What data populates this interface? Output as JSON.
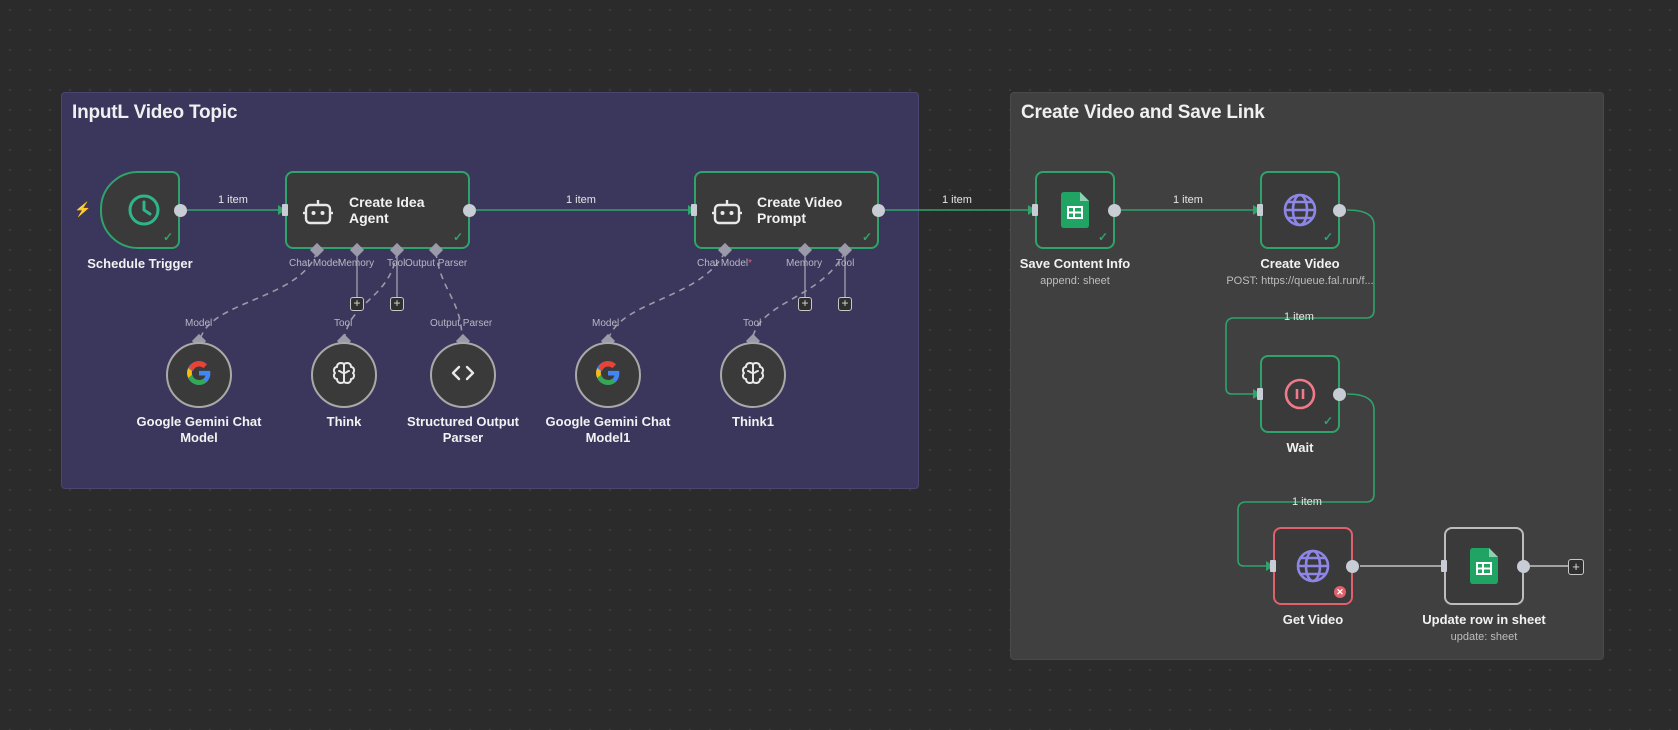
{
  "groups": {
    "input": {
      "title": "InputL Video Topic"
    },
    "create": {
      "title": "Create Video and Save Link"
    }
  },
  "nodes": {
    "schedule": {
      "label": "Schedule Trigger",
      "icon": "clock-icon"
    },
    "idea_agent": {
      "title_line1": "Create Idea",
      "title_line2": "Agent",
      "icon": "robot-icon"
    },
    "video_prompt": {
      "title_line1": "Create Video",
      "title_line2": "Prompt",
      "icon": "robot-icon"
    },
    "save_content": {
      "label": "Save Content Info",
      "sub": "append: sheet",
      "icon": "google-sheets-icon"
    },
    "create_video": {
      "label": "Create Video",
      "sub": "POST: https://queue.fal.run/f...",
      "icon": "globe-icon"
    },
    "wait": {
      "label": "Wait",
      "icon": "pause-icon"
    },
    "get_video": {
      "label": "Get Video",
      "icon": "globe-icon"
    },
    "update_row": {
      "label": "Update row in sheet",
      "sub": "update: sheet",
      "icon": "google-sheets-icon"
    },
    "gemini1": {
      "label_line1": "Google Gemini Chat",
      "label_line2": "Model",
      "icon": "google-icon"
    },
    "think": {
      "label": "Think",
      "icon": "brain-icon"
    },
    "parser": {
      "label_line1": "Structured Output",
      "label_line2": "Parser",
      "icon": "code-icon"
    },
    "gemini2": {
      "label_line1": "Google Gemini Chat",
      "label_line2": "Model1",
      "icon": "google-icon"
    },
    "think1": {
      "label": "Think1",
      "icon": "brain-icon"
    }
  },
  "sub_ports": {
    "idea_agent": [
      "Chat Model",
      "Memory",
      "Tool",
      "Output Parser"
    ],
    "video_prompt": [
      "Chat Model",
      "Memory",
      "Tool"
    ],
    "required_marker": "*"
  },
  "sub_node_ports": {
    "gemini1": "Model",
    "think": "Tool",
    "parser": "Output Parser",
    "gemini2": "Model",
    "think1": "Tool"
  },
  "edge_label": "1 item",
  "plus": "+",
  "check_mark": "✓",
  "error_mark": "✕",
  "bolt": "⚡",
  "colors": {
    "success": "#2fa36b",
    "error": "#e0606b",
    "wire": "#2fa36b",
    "group_input_bg": "#3b365c",
    "group_create_bg": "#404040",
    "globe": "#8d86e6",
    "sheets": "#1fa463"
  }
}
